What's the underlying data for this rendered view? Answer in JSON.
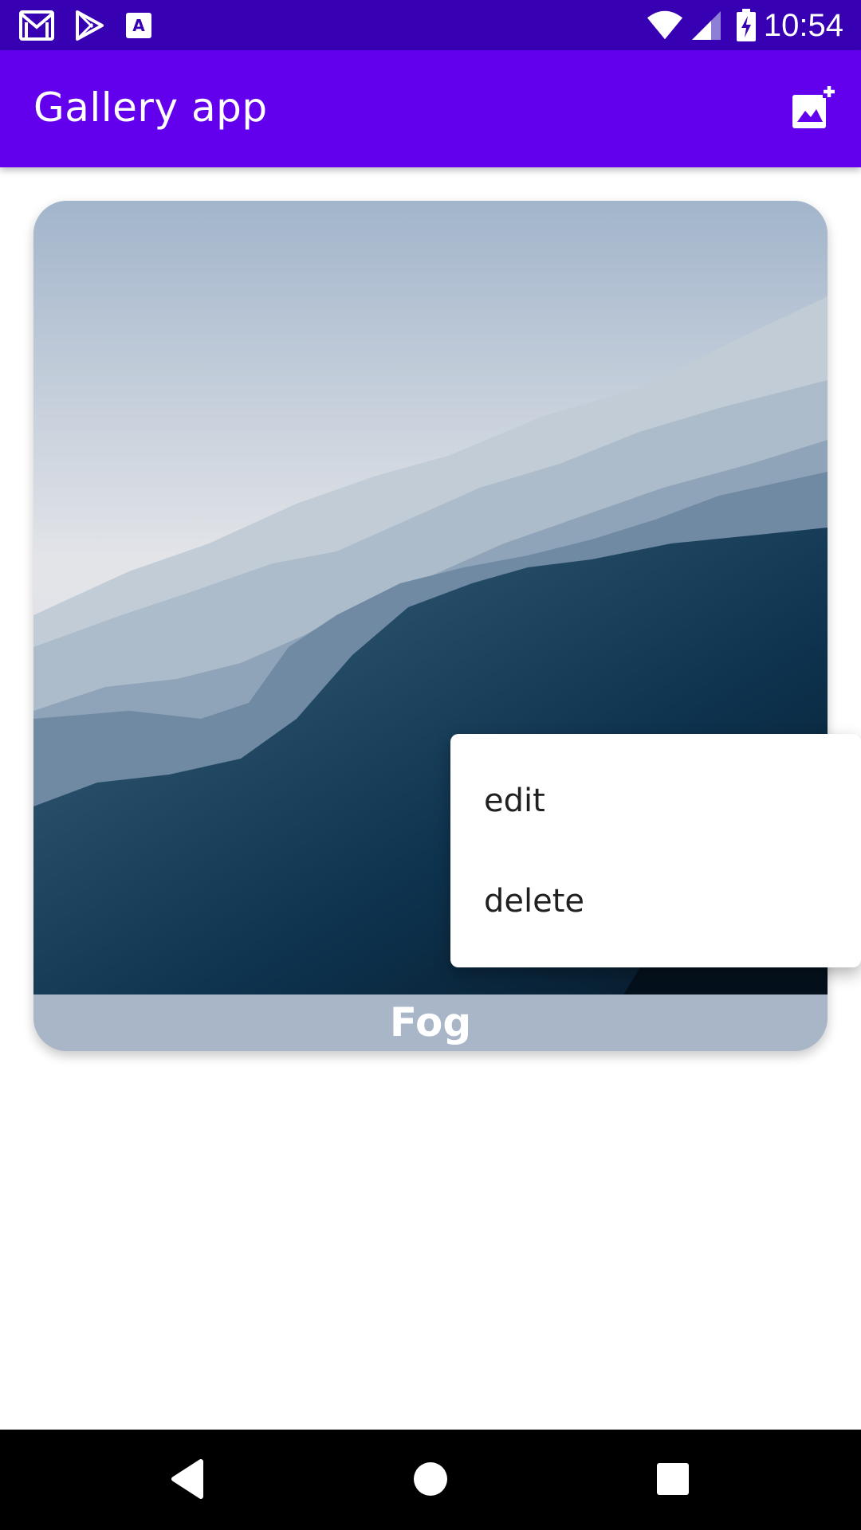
{
  "status_bar": {
    "time": "10:54",
    "icons": [
      "gmail-icon",
      "play-store-icon",
      "accessibility-a-icon",
      "wifi-icon",
      "cell-signal-icon",
      "battery-charging-icon"
    ]
  },
  "app_bar": {
    "title": "Gallery app",
    "action_icon": "add-photo-icon"
  },
  "gallery": {
    "items": [
      {
        "name": "Fog",
        "image": "foggy-mountains"
      }
    ]
  },
  "popup_menu": {
    "items": [
      {
        "label": "edit"
      },
      {
        "label": "delete"
      }
    ]
  },
  "nav_bar": {
    "icons": [
      "back-icon",
      "home-icon",
      "recents-icon"
    ]
  },
  "colors": {
    "status_bar": "#3700b3",
    "app_bar": "#6200ee",
    "card_label_bg": "#a8b6c8",
    "nav_bar": "#000000"
  }
}
